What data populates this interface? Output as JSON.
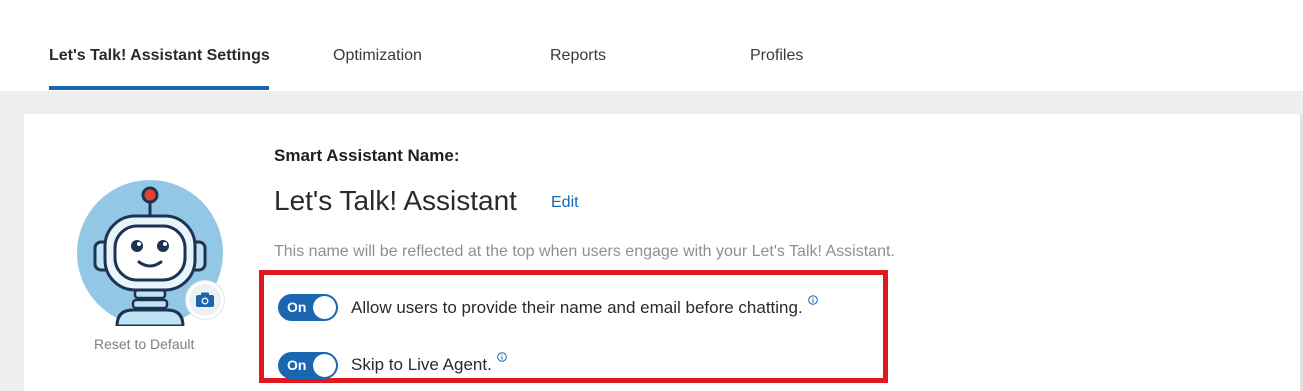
{
  "tabs": [
    {
      "label": "Let's Talk! Assistant Settings",
      "active": true
    },
    {
      "label": "Optimization",
      "active": false
    },
    {
      "label": "Reports",
      "active": false
    },
    {
      "label": "Profiles",
      "active": false
    }
  ],
  "avatar": {
    "icon": "robot-avatar",
    "camera_icon": "camera-icon",
    "reset_label": "Reset to Default"
  },
  "assistant": {
    "name_label": "Smart Assistant Name:",
    "name": "Let's Talk! Assistant",
    "edit_label": "Edit",
    "help_text": "This name will be reflected at the top when users engage with your Let's Talk! Assistant."
  },
  "settings": [
    {
      "toggle_text": "On",
      "label": "Allow users to provide their name and email before chatting.",
      "enabled": true,
      "info_icon": "info-icon"
    },
    {
      "toggle_text": "On",
      "label": "Skip to Live Agent.",
      "enabled": true,
      "info_icon": "info-icon"
    }
  ],
  "colors": {
    "accent": "#1a66b0",
    "highlight": "#e0191f",
    "background": "#efefef"
  }
}
